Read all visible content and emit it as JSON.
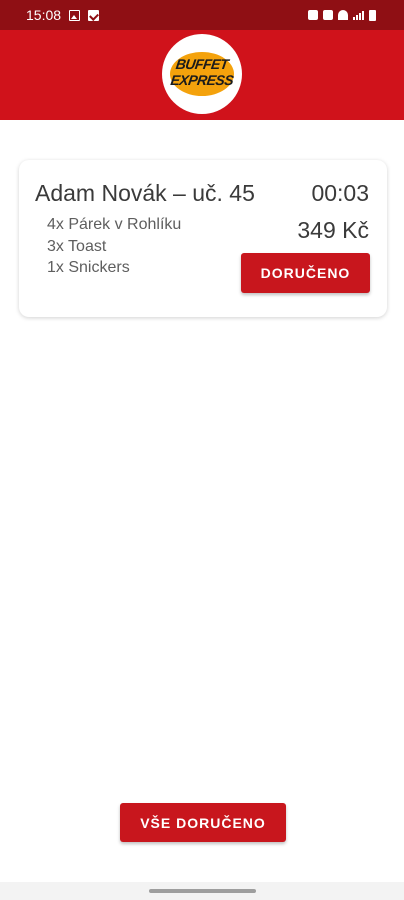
{
  "status_bar": {
    "time": "15:08",
    "left_icons": [
      "image-icon",
      "check-icon"
    ],
    "right_icons": [
      "alarm-icon",
      "mute-icon",
      "wifi-icon",
      "signal-icon",
      "battery-icon"
    ]
  },
  "header": {
    "logo_line1": "BUFFET",
    "logo_line2": "EXPRESS",
    "colors": {
      "app_bar": "#d0121b",
      "status_bar": "#8f0f14",
      "logo_bun": "#f4a20c"
    }
  },
  "order": {
    "customer": "Adam Novák – uč. 45",
    "time": "00:03",
    "items": [
      "4x Párek v Rohlíku",
      "3x Toast",
      "1x Snickers"
    ],
    "price": "349 Kč",
    "action_label": "DORUČENO"
  },
  "footer": {
    "all_delivered_label": "VŠE DORUČENO"
  },
  "accent_color": "#c8161d"
}
